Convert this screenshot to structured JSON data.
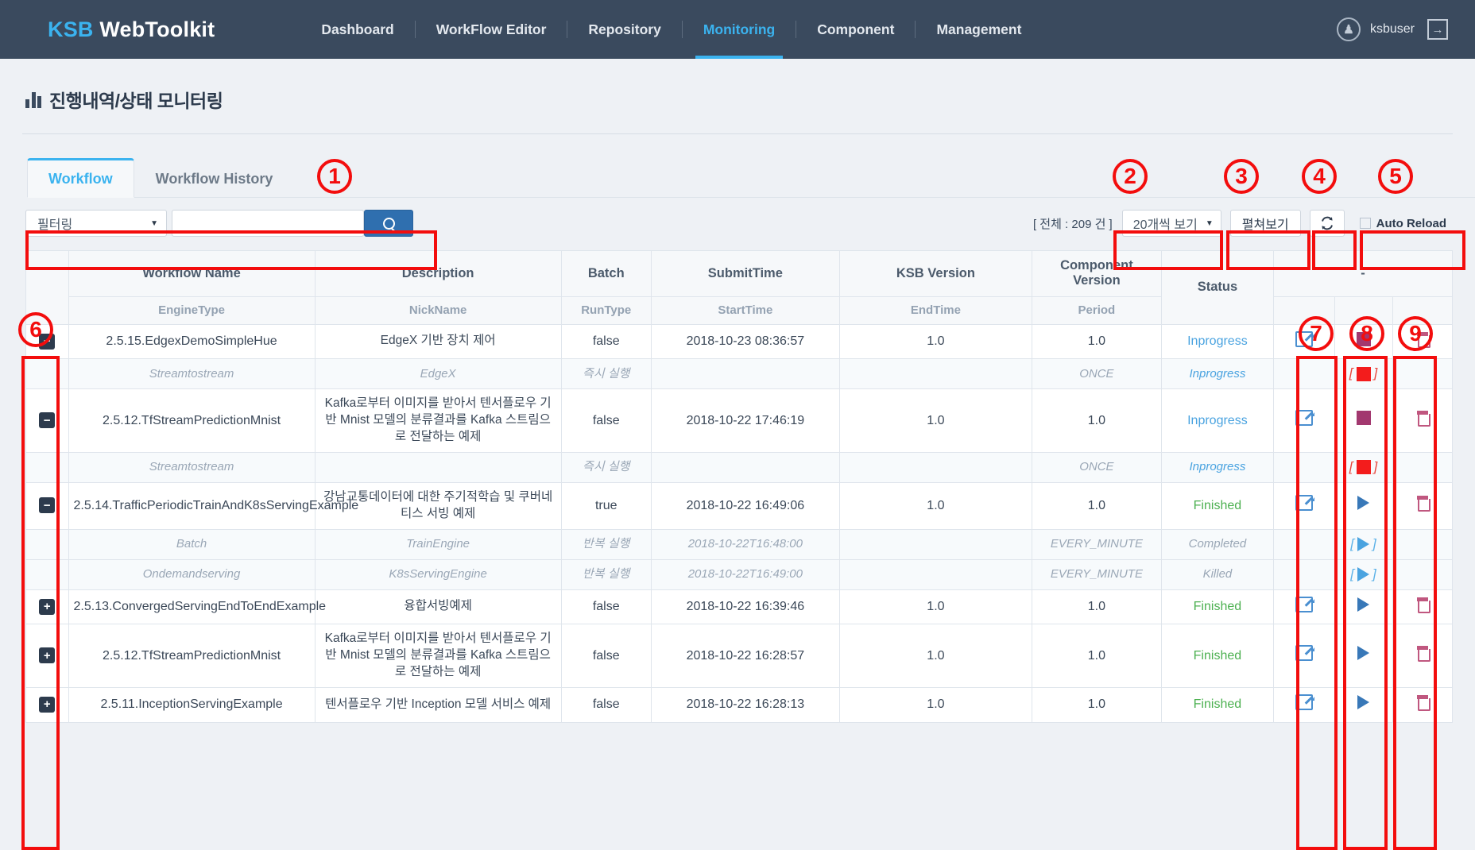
{
  "navbar": {
    "brand_primary": "KSB",
    "brand_secondary": "WebToolkit",
    "links": [
      "Dashboard",
      "WorkFlow Editor",
      "Repository",
      "Monitoring",
      "Component",
      "Management"
    ],
    "active_link": "Monitoring",
    "user_name": "ksbuser",
    "user_icon": "user-circle-icon",
    "logout_icon": "logout-icon"
  },
  "page": {
    "title": "진행내역/상태 모니터링",
    "title_icon": "bar-chart-icon"
  },
  "tabs": [
    {
      "label": "Workflow",
      "active": true
    },
    {
      "label": "Workflow History",
      "active": false
    }
  ],
  "toolbar": {
    "filter_label": "필터링",
    "search_value": "",
    "search_placeholder": "",
    "search_icon": "search-icon",
    "total_count": "[ 전체 : 209 건 ]",
    "page_size": "20개씩 보기",
    "expand_label": "펼쳐보기",
    "reload_icon": "refresh-icon",
    "auto_reload_label": "Auto Reload",
    "auto_reload_checked": false
  },
  "table": {
    "headers_main": [
      "",
      "Workflow Name",
      "Description",
      "Batch",
      "SubmitTime",
      "KSB Version",
      "Component Version",
      "Status",
      "-"
    ],
    "headers_sub": [
      "",
      "EngineType",
      "NickName",
      "RunType",
      "StartTime",
      "EndTime",
      "Period",
      ""
    ],
    "action_header": "-",
    "rows": [
      {
        "type": "main",
        "toggle": "minus",
        "name": "2.5.15.EdgexDemoSimpleHue",
        "desc": "EdgeX 기반 장치 제어",
        "batch": "false",
        "submit_time": "2018-10-23 08:36:57",
        "ksb_version": "1.0",
        "component_version": "1.0",
        "status": "Inprogress",
        "status_kind": "inprogress",
        "actions": {
          "edit": true,
          "run": "stop",
          "delete": true
        }
      },
      {
        "type": "sub",
        "engine_type": "Streamtostream",
        "nick_name": "EdgeX",
        "run_type": "즉시 실행",
        "start_time": "",
        "end_time": "",
        "period": "ONCE",
        "status": "Inprogress",
        "status_kind": "inprogress",
        "actions": {
          "edit": false,
          "run": "stop-bracket",
          "delete": false
        }
      },
      {
        "type": "main",
        "toggle": "minus",
        "name": "2.5.12.TfStreamPredictionMnist",
        "desc": "Kafka로부터 이미지를 받아서 텐서플로우 기반 Mnist 모델의 분류결과를 Kafka 스트림으로 전달하는 예제",
        "batch": "false",
        "submit_time": "2018-10-22 17:46:19",
        "ksb_version": "1.0",
        "component_version": "1.0",
        "status": "Inprogress",
        "status_kind": "inprogress",
        "actions": {
          "edit": true,
          "run": "stop",
          "delete": true
        }
      },
      {
        "type": "sub",
        "engine_type": "Streamtostream",
        "nick_name": "",
        "run_type": "즉시 실행",
        "start_time": "",
        "end_time": "",
        "period": "ONCE",
        "status": "Inprogress",
        "status_kind": "inprogress",
        "actions": {
          "edit": false,
          "run": "stop-bracket",
          "delete": false
        }
      },
      {
        "type": "main",
        "toggle": "minus",
        "name": "2.5.14.TrafficPeriodicTrainAndK8sServingExample",
        "desc": "강남교통데이터에 대한 주기적학습 및 쿠버네티스 서빙 예제",
        "batch": "true",
        "submit_time": "2018-10-22 16:49:06",
        "ksb_version": "1.0",
        "component_version": "1.0",
        "status": "Finished",
        "status_kind": "finished",
        "actions": {
          "edit": true,
          "run": "play",
          "delete": true
        }
      },
      {
        "type": "sub",
        "engine_type": "Batch",
        "nick_name": "TrainEngine",
        "run_type": "반복 실행",
        "start_time": "2018-10-22T16:48:00",
        "end_time": "",
        "period": "EVERY_MINUTE",
        "status": "Completed",
        "status_kind": "completed",
        "actions": {
          "edit": false,
          "run": "play-bracket",
          "delete": false
        }
      },
      {
        "type": "sub",
        "engine_type": "Ondemandserving",
        "nick_name": "K8sServingEngine",
        "run_type": "반복 실행",
        "start_time": "2018-10-22T16:49:00",
        "end_time": "",
        "period": "EVERY_MINUTE",
        "status": "Killed",
        "status_kind": "killed",
        "actions": {
          "edit": false,
          "run": "play-bracket",
          "delete": false
        }
      },
      {
        "type": "main",
        "toggle": "plus",
        "name": "2.5.13.ConvergedServingEndToEndExample",
        "desc": "융합서빙예제",
        "batch": "false",
        "submit_time": "2018-10-22 16:39:46",
        "ksb_version": "1.0",
        "component_version": "1.0",
        "status": "Finished",
        "status_kind": "finished",
        "actions": {
          "edit": true,
          "run": "play",
          "delete": true
        }
      },
      {
        "type": "main",
        "toggle": "plus",
        "name": "2.5.12.TfStreamPredictionMnist",
        "desc": "Kafka로부터 이미지를 받아서 텐서플로우 기반 Mnist 모델의 분류결과를 Kafka 스트림으로 전달하는 예제",
        "batch": "false",
        "submit_time": "2018-10-22 16:28:57",
        "ksb_version": "1.0",
        "component_version": "1.0",
        "status": "Finished",
        "status_kind": "finished",
        "actions": {
          "edit": true,
          "run": "play",
          "delete": true
        }
      },
      {
        "type": "main",
        "toggle": "plus",
        "name": "2.5.11.InceptionServingExample",
        "desc": "텐서플로우 기반 Inception 모델 서비스 예제",
        "batch": "false",
        "submit_time": "2018-10-22 16:28:13",
        "ksb_version": "1.0",
        "component_version": "1.0",
        "status": "Finished",
        "status_kind": "finished",
        "actions": {
          "edit": true,
          "run": "play",
          "delete": true
        }
      }
    ]
  },
  "annotations": {
    "markers": [
      "1",
      "2",
      "3",
      "4",
      "5",
      "6",
      "7",
      "8",
      "9"
    ]
  }
}
